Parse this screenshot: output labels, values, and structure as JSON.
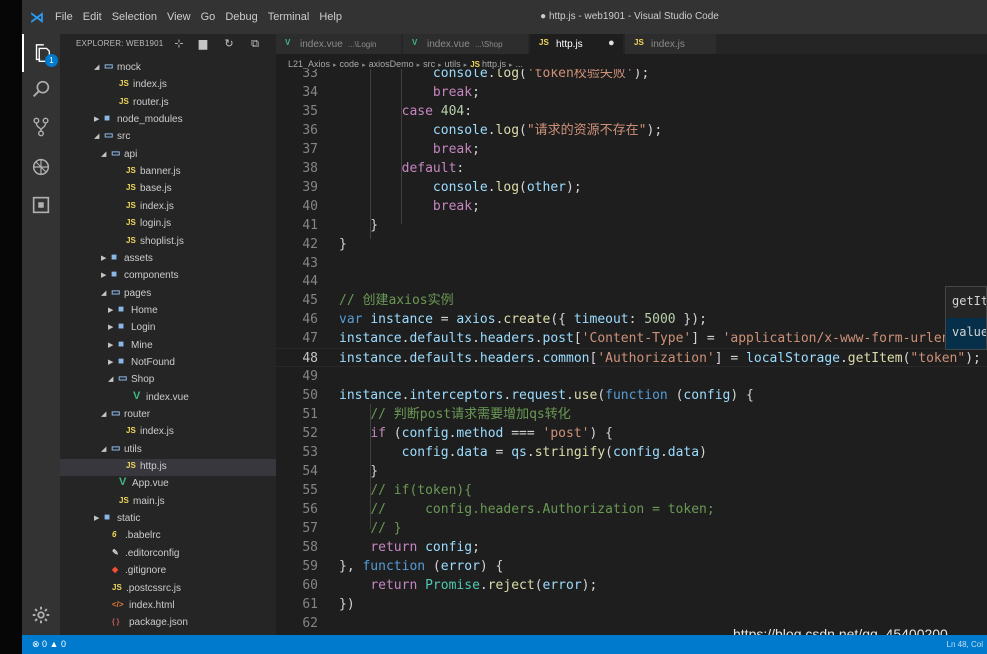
{
  "titlebar": {
    "menu": [
      "File",
      "Edit",
      "Selection",
      "View",
      "Go",
      "Debug",
      "Terminal",
      "Help"
    ],
    "window_title": "● http.js - web1901 - Visual Studio Code"
  },
  "activity": {
    "explorer_badge": "1"
  },
  "explorer": {
    "title": "EXPLORER: WEB1901",
    "items": [
      {
        "label": "mock",
        "kind": "folder-open",
        "depth": 2
      },
      {
        "label": "index.js",
        "kind": "js",
        "depth": 3
      },
      {
        "label": "router.js",
        "kind": "js",
        "depth": 3
      },
      {
        "label": "node_modules",
        "kind": "folder-closed",
        "depth": 2
      },
      {
        "label": "src",
        "kind": "folder-open",
        "depth": 2
      },
      {
        "label": "api",
        "kind": "folder-open",
        "depth": 3
      },
      {
        "label": "banner.js",
        "kind": "js",
        "depth": 4
      },
      {
        "label": "base.js",
        "kind": "js",
        "depth": 4
      },
      {
        "label": "index.js",
        "kind": "js",
        "depth": 4
      },
      {
        "label": "login.js",
        "kind": "js",
        "depth": 4
      },
      {
        "label": "shoplist.js",
        "kind": "js",
        "depth": 4
      },
      {
        "label": "assets",
        "kind": "folder-closed",
        "depth": 3
      },
      {
        "label": "components",
        "kind": "folder-closed",
        "depth": 3
      },
      {
        "label": "pages",
        "kind": "folder-open",
        "depth": 3
      },
      {
        "label": "Home",
        "kind": "folder-closed",
        "depth": 4
      },
      {
        "label": "Login",
        "kind": "folder-closed",
        "depth": 4
      },
      {
        "label": "Mine",
        "kind": "folder-closed",
        "depth": 4
      },
      {
        "label": "NotFound",
        "kind": "folder-closed",
        "depth": 4
      },
      {
        "label": "Shop",
        "kind": "folder-open",
        "depth": 4
      },
      {
        "label": "index.vue",
        "kind": "vue",
        "depth": 5
      },
      {
        "label": "router",
        "kind": "folder-open",
        "depth": 3
      },
      {
        "label": "index.js",
        "kind": "js",
        "depth": 4
      },
      {
        "label": "utils",
        "kind": "folder-open",
        "depth": 3
      },
      {
        "label": "http.js",
        "kind": "js",
        "depth": 4,
        "selected": true
      },
      {
        "label": "App.vue",
        "kind": "vue",
        "depth": 3
      },
      {
        "label": "main.js",
        "kind": "js",
        "depth": 3
      },
      {
        "label": "static",
        "kind": "folder-closed",
        "depth": 2
      },
      {
        "label": ".babelrc",
        "kind": "babel",
        "depth": 2
      },
      {
        "label": ".editorconfig",
        "kind": "editor",
        "depth": 2
      },
      {
        "label": ".gitignore",
        "kind": "git",
        "depth": 2
      },
      {
        "label": ".postcssrc.js",
        "kind": "js",
        "depth": 2
      },
      {
        "label": "index.html",
        "kind": "html",
        "depth": 2
      },
      {
        "label": "package.json",
        "kind": "json",
        "depth": 2
      }
    ]
  },
  "tabs": [
    {
      "label": "index.vue",
      "desc": "...\\Login",
      "kind": "vue",
      "active": false
    },
    {
      "label": "index.vue",
      "desc": "...\\Shop",
      "kind": "vue",
      "active": false
    },
    {
      "label": "http.js",
      "desc": "",
      "kind": "js",
      "active": true,
      "dirty": true
    },
    {
      "label": "index.js",
      "desc": "",
      "kind": "js",
      "active": false
    }
  ],
  "breadcrumb": [
    "L21_Axios",
    "code",
    "axiosDemo",
    "src",
    "utils",
    "http.js",
    "..."
  ],
  "code_lines": [
    {
      "n": "33",
      "t": [
        [
          "pun",
          "            "
        ],
        [
          "var",
          "console"
        ],
        [
          "pun",
          "."
        ],
        [
          "fn",
          "log"
        ],
        [
          "pun",
          "("
        ],
        [
          "str",
          "'token校验失败'"
        ],
        [
          "pun",
          ");"
        ]
      ]
    },
    {
      "n": "34",
      "t": [
        [
          "pun",
          "            "
        ],
        [
          "ctl",
          "break"
        ],
        [
          "pun",
          ";"
        ]
      ]
    },
    {
      "n": "35",
      "t": [
        [
          "pun",
          "        "
        ],
        [
          "ctl",
          "case"
        ],
        [
          "pun",
          " "
        ],
        [
          "num",
          "404"
        ],
        [
          "pun",
          ":"
        ]
      ]
    },
    {
      "n": "36",
      "t": [
        [
          "pun",
          "            "
        ],
        [
          "var",
          "console"
        ],
        [
          "pun",
          "."
        ],
        [
          "fn",
          "log"
        ],
        [
          "pun",
          "("
        ],
        [
          "str",
          "\"请求的资源不存在\""
        ],
        [
          "pun",
          ");"
        ]
      ]
    },
    {
      "n": "37",
      "t": [
        [
          "pun",
          "            "
        ],
        [
          "ctl",
          "break"
        ],
        [
          "pun",
          ";"
        ]
      ]
    },
    {
      "n": "38",
      "t": [
        [
          "pun",
          "        "
        ],
        [
          "ctl",
          "default"
        ],
        [
          "pun",
          ":"
        ]
      ]
    },
    {
      "n": "39",
      "t": [
        [
          "pun",
          "            "
        ],
        [
          "var",
          "console"
        ],
        [
          "pun",
          "."
        ],
        [
          "fn",
          "log"
        ],
        [
          "pun",
          "("
        ],
        [
          "var",
          "other"
        ],
        [
          "pun",
          ");"
        ]
      ]
    },
    {
      "n": "40",
      "t": [
        [
          "pun",
          "            "
        ],
        [
          "ctl",
          "break"
        ],
        [
          "pun",
          ";"
        ]
      ]
    },
    {
      "n": "41",
      "t": [
        [
          "pun",
          "    }"
        ]
      ]
    },
    {
      "n": "42",
      "t": [
        [
          "pun",
          "}"
        ]
      ]
    },
    {
      "n": "43",
      "t": []
    },
    {
      "n": "44",
      "t": []
    },
    {
      "n": "45",
      "t": [
        [
          "cmt",
          "// 创建axios实例"
        ]
      ]
    },
    {
      "n": "46",
      "t": [
        [
          "kw",
          "var"
        ],
        [
          "pun",
          " "
        ],
        [
          "var",
          "instance"
        ],
        [
          "pun",
          " = "
        ],
        [
          "var",
          "axios"
        ],
        [
          "pun",
          "."
        ],
        [
          "fn",
          "create"
        ],
        [
          "pun",
          "({ "
        ],
        [
          "var",
          "timeout"
        ],
        [
          "pun",
          ": "
        ],
        [
          "num",
          "5000"
        ],
        [
          "pun",
          " });"
        ]
      ]
    },
    {
      "n": "47",
      "t": [
        [
          "var",
          "instance"
        ],
        [
          "pun",
          "."
        ],
        [
          "var",
          "defaults"
        ],
        [
          "pun",
          "."
        ],
        [
          "var",
          "headers"
        ],
        [
          "pun",
          "."
        ],
        [
          "var",
          "post"
        ],
        [
          "pun",
          "["
        ],
        [
          "str",
          "'Content-Type'"
        ],
        [
          "pun",
          "] = "
        ],
        [
          "str",
          "'application/x-www-form-urlencoded'"
        ]
      ]
    },
    {
      "n": "48",
      "t": [
        [
          "var",
          "instance"
        ],
        [
          "pun",
          "."
        ],
        [
          "var",
          "defaults"
        ],
        [
          "pun",
          "."
        ],
        [
          "var",
          "headers"
        ],
        [
          "pun",
          "."
        ],
        [
          "var",
          "common"
        ],
        [
          "pun",
          "["
        ],
        [
          "str",
          "'Authorization'"
        ],
        [
          "pun",
          "] = "
        ],
        [
          "var",
          "localStorage"
        ],
        [
          "pun",
          "."
        ],
        [
          "fn",
          "getItem"
        ],
        [
          "pun",
          "("
        ],
        [
          "str",
          "\"token\""
        ],
        [
          "pun",
          ");"
        ]
      ],
      "current": true
    },
    {
      "n": "49",
      "t": []
    },
    {
      "n": "50",
      "t": [
        [
          "var",
          "instance"
        ],
        [
          "pun",
          "."
        ],
        [
          "var",
          "interceptors"
        ],
        [
          "pun",
          "."
        ],
        [
          "var",
          "request"
        ],
        [
          "pun",
          "."
        ],
        [
          "fn",
          "use"
        ],
        [
          "pun",
          "("
        ],
        [
          "kw",
          "function"
        ],
        [
          "pun",
          " ("
        ],
        [
          "var",
          "config"
        ],
        [
          "pun",
          ") {"
        ]
      ]
    },
    {
      "n": "51",
      "t": [
        [
          "pun",
          "    "
        ],
        [
          "cmt",
          "// 判断post请求需要增加qs转化"
        ]
      ]
    },
    {
      "n": "52",
      "t": [
        [
          "pun",
          "    "
        ],
        [
          "ctl",
          "if"
        ],
        [
          "pun",
          " ("
        ],
        [
          "var",
          "config"
        ],
        [
          "pun",
          "."
        ],
        [
          "var",
          "method"
        ],
        [
          "pun",
          " === "
        ],
        [
          "str",
          "'post'"
        ],
        [
          "pun",
          ") {"
        ]
      ]
    },
    {
      "n": "53",
      "t": [
        [
          "pun",
          "        "
        ],
        [
          "var",
          "config"
        ],
        [
          "pun",
          "."
        ],
        [
          "var",
          "data"
        ],
        [
          "pun",
          " = "
        ],
        [
          "var",
          "qs"
        ],
        [
          "pun",
          "."
        ],
        [
          "fn",
          "stringify"
        ],
        [
          "pun",
          "("
        ],
        [
          "var",
          "config"
        ],
        [
          "pun",
          "."
        ],
        [
          "var",
          "data"
        ],
        [
          "pun",
          ")"
        ]
      ]
    },
    {
      "n": "54",
      "t": [
        [
          "pun",
          "    }"
        ]
      ]
    },
    {
      "n": "55",
      "t": [
        [
          "pun",
          "    "
        ],
        [
          "cmt",
          "// if(token){"
        ]
      ]
    },
    {
      "n": "56",
      "t": [
        [
          "pun",
          "    "
        ],
        [
          "cmt",
          "//     config.headers.Authorization = token;"
        ]
      ]
    },
    {
      "n": "57",
      "t": [
        [
          "pun",
          "    "
        ],
        [
          "cmt",
          "// }"
        ]
      ]
    },
    {
      "n": "58",
      "t": [
        [
          "pun",
          "    "
        ],
        [
          "ctl",
          "return"
        ],
        [
          "pun",
          " "
        ],
        [
          "var",
          "config"
        ],
        [
          "pun",
          ";"
        ]
      ]
    },
    {
      "n": "59",
      "t": [
        [
          "pun",
          "}, "
        ],
        [
          "kw",
          "function"
        ],
        [
          "pun",
          " ("
        ],
        [
          "var",
          "error"
        ],
        [
          "pun",
          ") {"
        ]
      ]
    },
    {
      "n": "60",
      "t": [
        [
          "pun",
          "    "
        ],
        [
          "ctl",
          "return"
        ],
        [
          "pun",
          " "
        ],
        [
          "cls",
          "Promise"
        ],
        [
          "pun",
          "."
        ],
        [
          "fn",
          "reject"
        ],
        [
          "pun",
          "("
        ],
        [
          "var",
          "error"
        ],
        [
          "pun",
          ");"
        ]
      ]
    },
    {
      "n": "61",
      "t": [
        [
          "pun",
          "})"
        ]
      ]
    },
    {
      "n": "62",
      "t": []
    }
  ],
  "suggest": [
    "getItem",
    "value"
  ],
  "watermark": "https://blog.csdn.net/qq_45400200",
  "status": {
    "problems": "⊗ 0 ▲ 0",
    "position": "Ln 48, Col"
  }
}
